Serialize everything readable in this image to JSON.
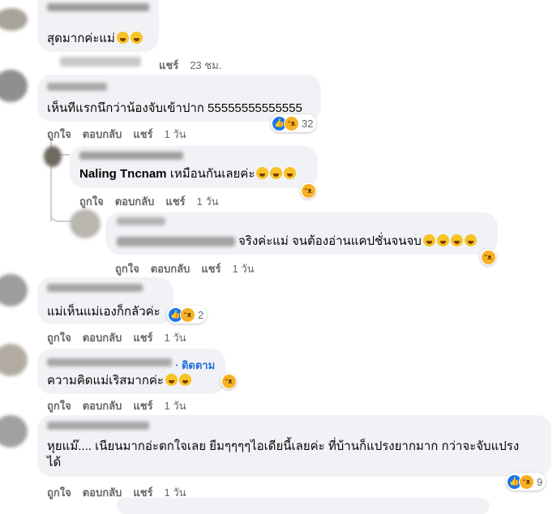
{
  "comments": [
    {
      "text": "สุดมากค่ะแม่",
      "actions": {
        "share": "แชร์",
        "time": "23 ชม."
      }
    },
    {
      "text": "เห็นทีแรกนึกว่าน้องจับเข้าปาก 55555555555555",
      "actions": {
        "like": "ถูกใจ",
        "reply": "ตอบกลับ",
        "share": "แชร์",
        "time": "1 วัน"
      },
      "reaction_count": "32"
    },
    {
      "tagged": "Naling Tncnam",
      "text": "เหมือนกันเลยค่ะ",
      "actions": {
        "like": "ถูกใจ",
        "reply": "ตอบกลับ",
        "share": "แชร์",
        "time": "1 วัน"
      }
    },
    {
      "text": "จริงค่ะแม่ จนต้องอ่านแคปชั่นจนจบ",
      "actions": {
        "like": "ถูกใจ",
        "reply": "ตอบกลับ",
        "share": "แชร์",
        "time": "1 วัน"
      }
    },
    {
      "text": "แม่เห็นแม่เองก็กลัวค่ะ",
      "actions": {
        "like": "ถูกใจ",
        "reply": "ตอบกลับ",
        "share": "แชร์",
        "time": "1 วัน"
      },
      "reaction_count": "2"
    },
    {
      "follow": "· ติดตาม",
      "text": "ความคิดแม่เริสมากค่ะ",
      "actions": {
        "like": "ถูกใจ",
        "reply": "ตอบกลับ",
        "share": "แชร์",
        "time": "1 วัน"
      }
    },
    {
      "text_line1": "หุยแม๊.... เนียนมากอ่ะตกใจเลย ยืมๆๆๆๆไอเดียนี้เลยค่ะ ที่บ้านก็แปรงยากมาก กว่าจะจับแปรง",
      "text_line2": "ได้",
      "actions": {
        "like": "ถูกใจ",
        "reply": "ตอบกลับ",
        "share": "แชร์",
        "time": "1 วัน"
      },
      "reaction_count": "9"
    }
  ],
  "icons": {
    "like": "like-reaction-icon",
    "haha": "haha-reaction-icon",
    "emoji": "laughing-emoji-icon"
  },
  "colors": {
    "bubble": "#f0f2f5",
    "link": "#216fdb",
    "like": "#1877f2",
    "haha": "#f7b125",
    "meta": "#65676b"
  }
}
